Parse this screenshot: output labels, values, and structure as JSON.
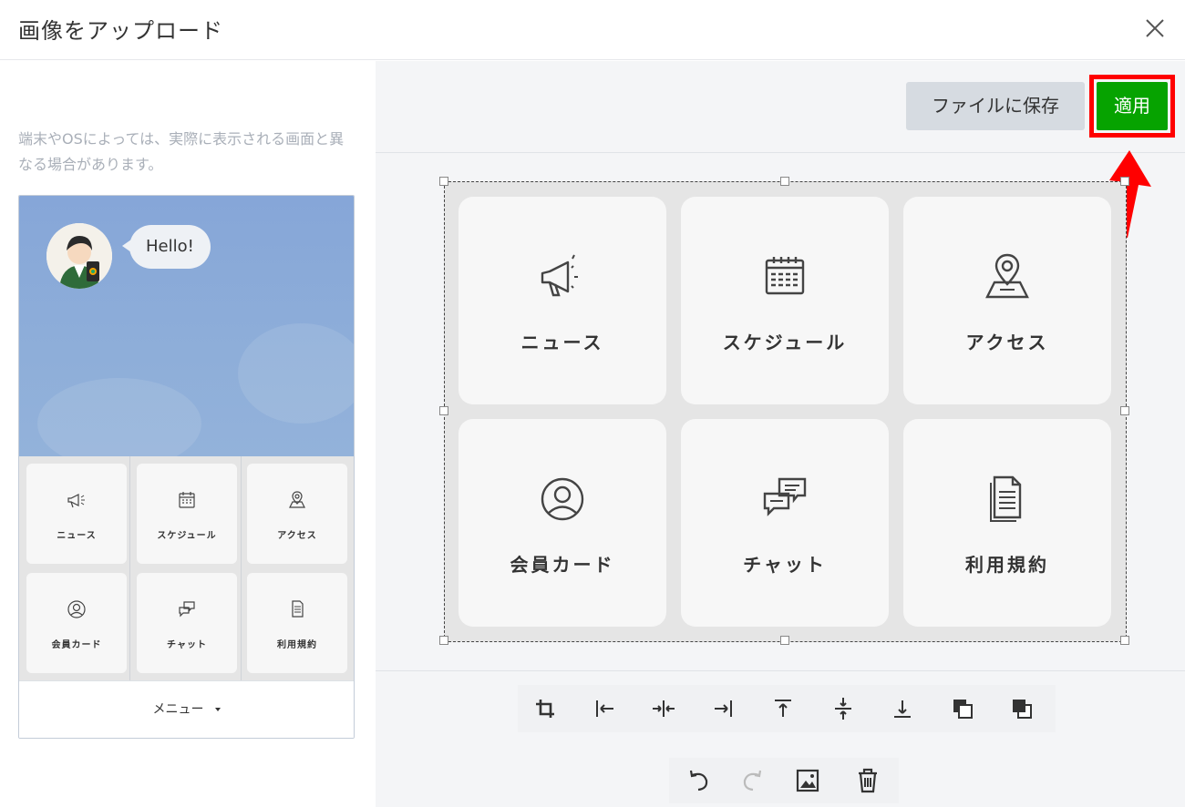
{
  "dialog": {
    "title": "画像をアップロード"
  },
  "icons": {
    "close": "close-icon"
  },
  "preview": {
    "note": "端末やOSによっては、実際に表示される画面と異なる場合があります。",
    "bubble_text": "Hello!",
    "menu_label": "メニュー",
    "tiles": [
      {
        "label": "ニュース",
        "icon": "megaphone-icon"
      },
      {
        "label": "スケジュール",
        "icon": "calendar-icon"
      },
      {
        "label": "アクセス",
        "icon": "map-pin-icon"
      },
      {
        "label": "会員カード",
        "icon": "user-circle-icon"
      },
      {
        "label": "チャット",
        "icon": "chat-bubbles-icon"
      },
      {
        "label": "利用規約",
        "icon": "document-icon"
      }
    ]
  },
  "editor": {
    "save_label": "ファイルに保存",
    "apply_label": "適用",
    "highlight_color": "#ff0000",
    "apply_color": "#06a300",
    "toolbar": [
      "crop-icon",
      "align-left-icon",
      "align-center-h-icon",
      "align-right-icon",
      "align-top-icon",
      "align-middle-v-icon",
      "align-bottom-icon",
      "bring-forward-icon",
      "send-backward-icon"
    ],
    "toolbar2": [
      "undo-icon",
      "redo-icon",
      "image-icon",
      "trash-icon"
    ]
  }
}
